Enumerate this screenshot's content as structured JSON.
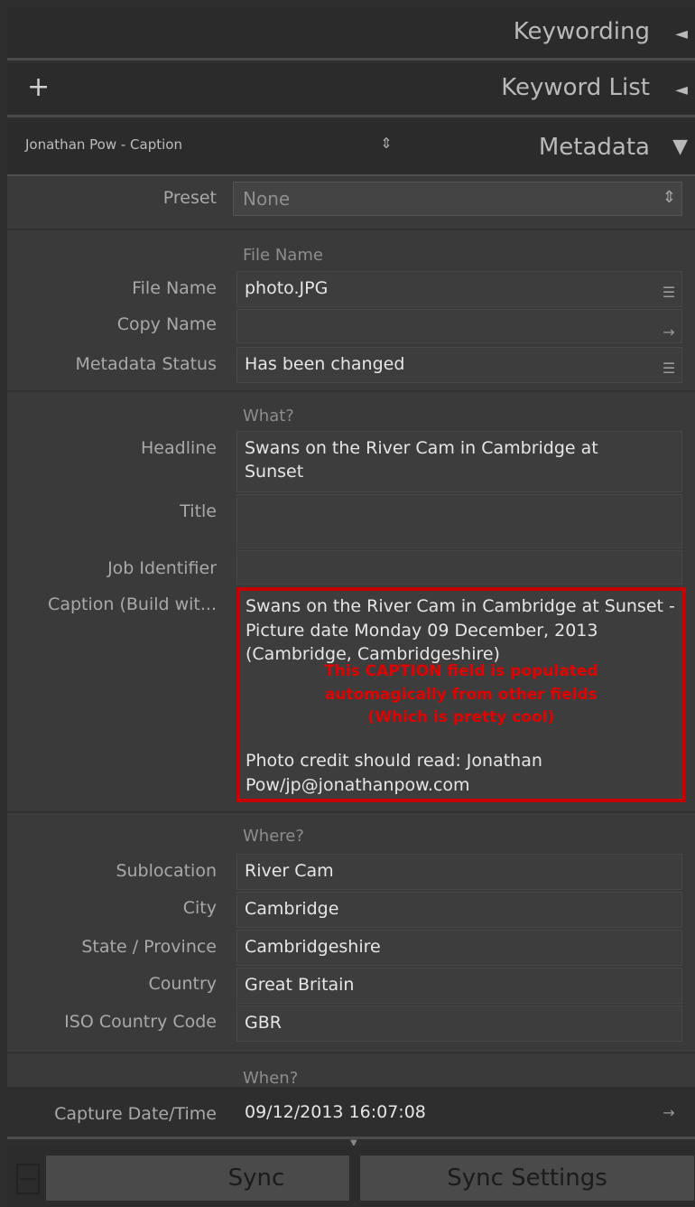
{
  "panels": {
    "keywording": {
      "title": "Keywording",
      "toggle": "◄"
    },
    "keyword_list": {
      "title": "Keyword List",
      "toggle": "◄",
      "add": "+"
    },
    "metadata": {
      "title": "Metadata",
      "toggle": "▼",
      "preset_dropdown": "Jonathan Pow - Caption",
      "stepper": "⇕"
    }
  },
  "preset": {
    "label": "Preset",
    "value": "None",
    "stepper": "⇕"
  },
  "groups": {
    "file": {
      "title": "File Name",
      "rows": [
        {
          "label": "File Name",
          "value": "photo.JPG",
          "btn": "☰"
        },
        {
          "label": "Copy Name",
          "value": "",
          "btn": "→"
        },
        {
          "label": "Metadata Status",
          "value": "Has been changed",
          "btn": "☰"
        }
      ]
    },
    "what": {
      "title": "What?",
      "headline": {
        "label": "Headline",
        "value": "Swans on the River Cam in Cambridge at Sunset"
      },
      "title_field": {
        "label": "Title",
        "value": ""
      },
      "job": {
        "label": "Job Identifier",
        "value": ""
      },
      "caption": {
        "label": "Caption (Build wit...",
        "value": "Swans on the River Cam in Cambridge at Sunset - Picture date Monday 09 December, 2013 (Cambridge, Cambridgeshire)",
        "note_line1": "This CAPTION field is populated",
        "note_line2": "automagically from other fields",
        "note_line3": "(Which is pretty cool)",
        "credit": "Photo credit should read: Jonathan Pow/jp@jonathanpow.com"
      }
    },
    "where": {
      "title": "Where?",
      "rows": [
        {
          "label": "Sublocation",
          "value": "River Cam"
        },
        {
          "label": "City",
          "value": "Cambridge"
        },
        {
          "label": "State / Province",
          "value": "Cambridgeshire"
        },
        {
          "label": "Country",
          "value": "Great Britain"
        },
        {
          "label": "ISO Country Code",
          "value": "GBR"
        }
      ]
    },
    "when": {
      "title": "When?",
      "capture": {
        "label": "Capture Date/Time",
        "value": "09/12/2013 16:07:08",
        "btn": "→"
      }
    }
  },
  "footer": {
    "sync": "Sync",
    "sync_settings": "Sync Settings"
  },
  "colors": {
    "highlight": "#c40000",
    "note_text": "#e00000"
  }
}
